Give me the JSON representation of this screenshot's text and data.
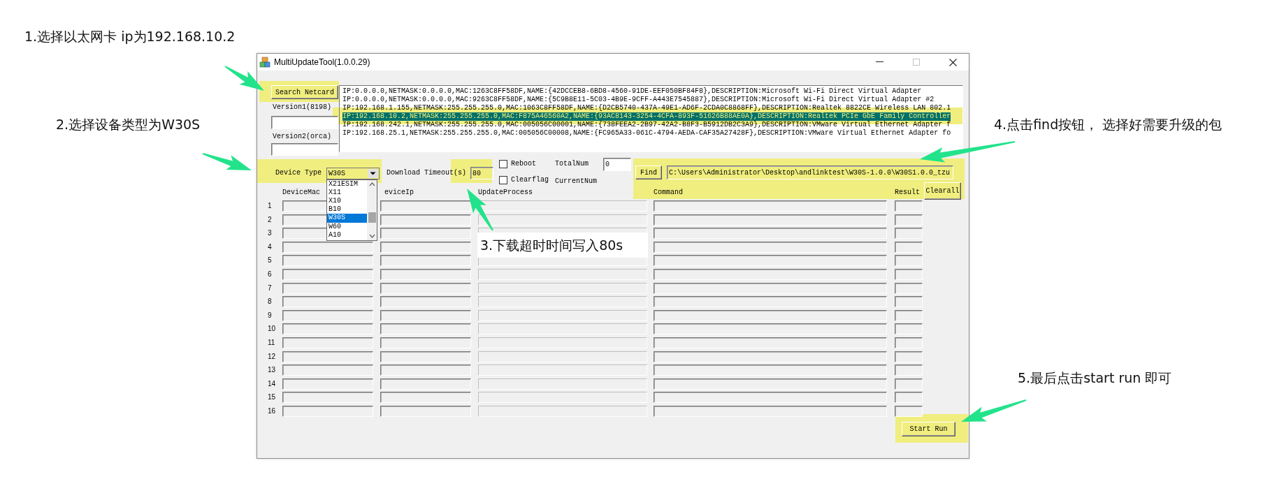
{
  "window": {
    "title": "MultiUpdateTool(1.0.0.29)"
  },
  "annotations": [
    {
      "text": "1.选择以太网卡 ip为192.168.10.2"
    },
    {
      "text": "2.选择设备类型为W30S"
    },
    {
      "text": "3.下载超时时间写入80s"
    },
    {
      "text": "4.点击find按钮， 选择好需要升级的包"
    },
    {
      "text": "5.最后点击start run 即可"
    }
  ],
  "search_button": "Search Netcard",
  "version1": {
    "label": "Version1(8198)"
  },
  "version2": {
    "label": "Version2(orca)"
  },
  "netcards": [
    {
      "text": "IP:0.0.0.0,NETMASK:0.0.0.0,MAC:1263C8FF58DF,NAME:{42DCCEB8-6BD8-4560-91DE-EEF050BF84F8},DESCRIPTION:Microsoft Wi-Fi Direct Virtual Adapter",
      "selected": false
    },
    {
      "text": "IP:0.0.0.0,NETMASK:0.0.0.0,MAC:9263C8FF58DF,NAME:{5C9B8E11-5C03-4B9E-9CFF-A443E7545887},DESCRIPTION:Microsoft Wi-Fi Direct Virtual Adapter #2",
      "selected": false
    },
    {
      "text": "IP:192.168.1.155,NETMASK:255.255.255.0,MAC:1063C8FF58DF,NAME:{D2CB5740-437A-49E1-AD6F-2CDA0C8868FF},DESCRIPTION:Realtek 8822CE Wireless LAN 802.1",
      "selected": false
    },
    {
      "text": "IP:192.168.10.2,NETMASK:255.255.255.0,MAC:F875A46560A2,NAME:{93AC8143-3254-4CFA-893F-51626B88AE0A},DESCRIPTION:Realtek PCIe GbE Family Controller",
      "selected": true
    },
    {
      "text": "IP:192.168.242.1,NETMASK:255.255.255.0,MAC:005056C00001,NAME:{738FEEA2-2B97-42A2-B8F3-B5912DB2C3A9},DESCRIPTION:VMware Virtual Ethernet Adapter f",
      "selected": false
    },
    {
      "text": "IP:192.168.25.1,NETMASK:255.255.255.0,MAC:005056C00008,NAME:{FC965A33-061C-4794-AEDA-CAF35A27428F},DESCRIPTION:VMware Virtual Ethernet Adapter fo",
      "selected": false
    }
  ],
  "device_type": {
    "label": "Device Type",
    "value": "W30S",
    "options": [
      {
        "label": "X21ESIM",
        "selected": false
      },
      {
        "label": "X11",
        "selected": false
      },
      {
        "label": "X10",
        "selected": false
      },
      {
        "label": "B10",
        "selected": false
      },
      {
        "label": "W30S",
        "selected": true
      },
      {
        "label": "W60",
        "selected": false
      },
      {
        "label": "A10",
        "selected": false
      }
    ]
  },
  "timeout": {
    "label": "Download Timeout(s)",
    "value": "80"
  },
  "checkboxes": [
    {
      "label": "Reboot",
      "checked": false
    },
    {
      "label": "Clearflag",
      "checked": false
    }
  ],
  "total_num": {
    "label": "TotalNum",
    "value": "0"
  },
  "current_num": {
    "label": "CurrentNum"
  },
  "find_button": "Find",
  "package_path": "C:\\Users\\Administrator\\Desktop\\andlinktest\\W30S-1.0.0\\W30S1.0.0_tzu",
  "columns": [
    "DeviceMac",
    "eviceIp",
    "UpdateProcess",
    "Command",
    "Result"
  ],
  "clear_button": "Clearall",
  "rows": [
    {
      "number": "1"
    },
    {
      "number": "2"
    },
    {
      "number": "3"
    },
    {
      "number": "4"
    },
    {
      "number": "5"
    },
    {
      "number": "6"
    },
    {
      "number": "7"
    },
    {
      "number": "8"
    },
    {
      "number": "9"
    },
    {
      "number": "10"
    },
    {
      "number": "11"
    },
    {
      "number": "12"
    },
    {
      "number": "13"
    },
    {
      "number": "14"
    },
    {
      "number": "15"
    },
    {
      "number": "16"
    }
  ],
  "start_button": "Start Run"
}
